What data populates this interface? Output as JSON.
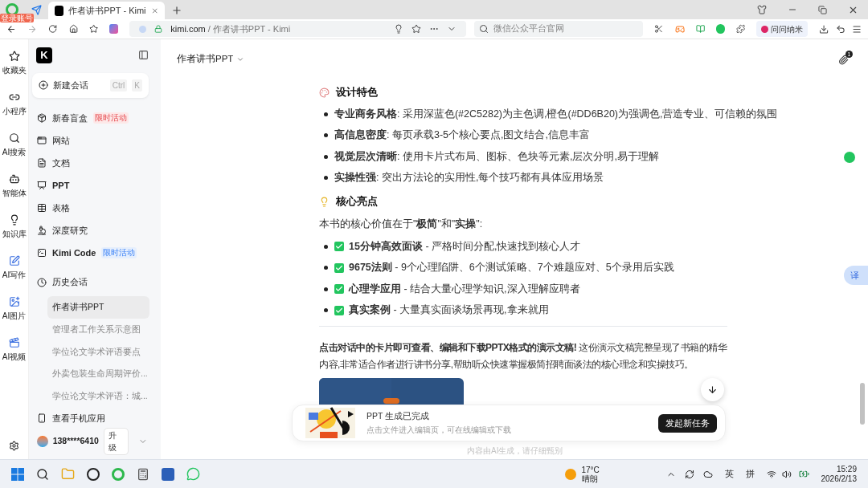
{
  "browser": {
    "login_badge": "登录账号",
    "tabs": [
      {
        "label": "作者讲书PPT - Kimi",
        "selected": true
      }
    ],
    "url": {
      "domain": "kimi.com",
      "path": " / 作者讲书PPT - Kimi"
    },
    "search": {
      "placeholder": "微信公众平台官网"
    },
    "extension_label": "问问纳米"
  },
  "rail": [
    {
      "label": "收藏夹"
    },
    {
      "label": "小程序"
    },
    {
      "label": "AI搜索"
    },
    {
      "label": "智能体"
    },
    {
      "label": "知识库"
    },
    {
      "label": "AI写作"
    },
    {
      "label": "AI图片"
    },
    {
      "label": "AI视频"
    }
  ],
  "sidebar": {
    "logo": "K",
    "new_chat": {
      "label": "新建会话",
      "keys": [
        "Ctrl",
        "K"
      ]
    },
    "nav": [
      {
        "label": "新春盲盒",
        "badge": "限时活动"
      },
      {
        "label": "网站"
      },
      {
        "label": "文档"
      },
      {
        "label": "PPT"
      },
      {
        "label": "表格"
      },
      {
        "label": "深度研究"
      },
      {
        "label": "Kimi Code",
        "badge": "限时活动"
      }
    ],
    "history": {
      "title": "历史会话",
      "items": [
        {
          "label": "作者讲书PPT",
          "selected": true
        },
        {
          "label": "管理者工作关系示意图",
          "selected": false
        },
        {
          "label": "学位论文学术评语要点",
          "selected": false
        },
        {
          "label": "外卖包装生命周期评价...",
          "selected": false
        },
        {
          "label": "学位论文学术评语：城...",
          "selected": false
        }
      ]
    },
    "mobile": "查看手机应用",
    "user": {
      "name": "138****6410",
      "upgrade": "升级"
    }
  },
  "main": {
    "title": "作者讲书PPT",
    "attachment_count": "1",
    "blocks": [
      {
        "kind": "heading",
        "text": "设计特色"
      },
      {
        "kind": "bullet",
        "text": "**专业商务风格**: 采用深蓝色(#2C5282)为主色调,橙色(#DD6B20)为强调色,营造专业、可信赖的氛围"
      },
      {
        "kind": "bullet",
        "text": "**高信息密度**: 每页承载3-5个核心要点,图文结合,信息丰富"
      },
      {
        "kind": "bullet",
        "text": "**视觉层次清晰**: 使用卡片式布局、图标、色块等元素,层次分明,易于理解"
      },
      {
        "kind": "bullet",
        "text": "**实操性强**: 突出方法论的实用性,每个技巧都有具体应用场景"
      },
      {
        "kind": "heading",
        "text": "核心亮点"
      },
      {
        "kind": "paragraph",
        "text": "本书的核心价值在于\"**极简**\"和\"**实操**\":"
      },
      {
        "kind": "check",
        "text": "**15分钟高效面谈** - 严格时间分配,快速找到核心人才"
      },
      {
        "kind": "check",
        "text": "**9675法则** - 9个心理陷阱、6个测试策略、7个难题应对、5个录用后实践"
      },
      {
        "kind": "check",
        "text": "**心理学应用** - 结合大量心理学知识,深入理解应聘者"
      },
      {
        "kind": "check",
        "text": "**真实案例** - 大量真实面谈场景再现,拿来就用"
      },
      {
        "kind": "rule"
      },
      {
        "kind": "paragraph",
        "text": "**点击对话中的卡片即可查看、编辑和下载PPTX格式的演示文稿!** 这份演示文稿完整呈现了书籍的精华内容,非常适合作者进行讲书分享,帮助听众快速掌握极简招聘面谈法的核心理念和实操技巧。"
      },
      {
        "kind": "slide"
      }
    ],
    "notice": {
      "title": "PPT 生成已完成",
      "subtitle": "点击文件进入编辑页，可在线编辑或下载",
      "button": "发起新任务"
    },
    "disclaimer": "内容由AI生成，请仔细甄别",
    "translate": "译"
  },
  "taskbar": {
    "temperature": "17°C",
    "weather": "晴朗",
    "ime": [
      "英",
      "拼"
    ],
    "time": "15:29",
    "date": "2026/2/13"
  }
}
